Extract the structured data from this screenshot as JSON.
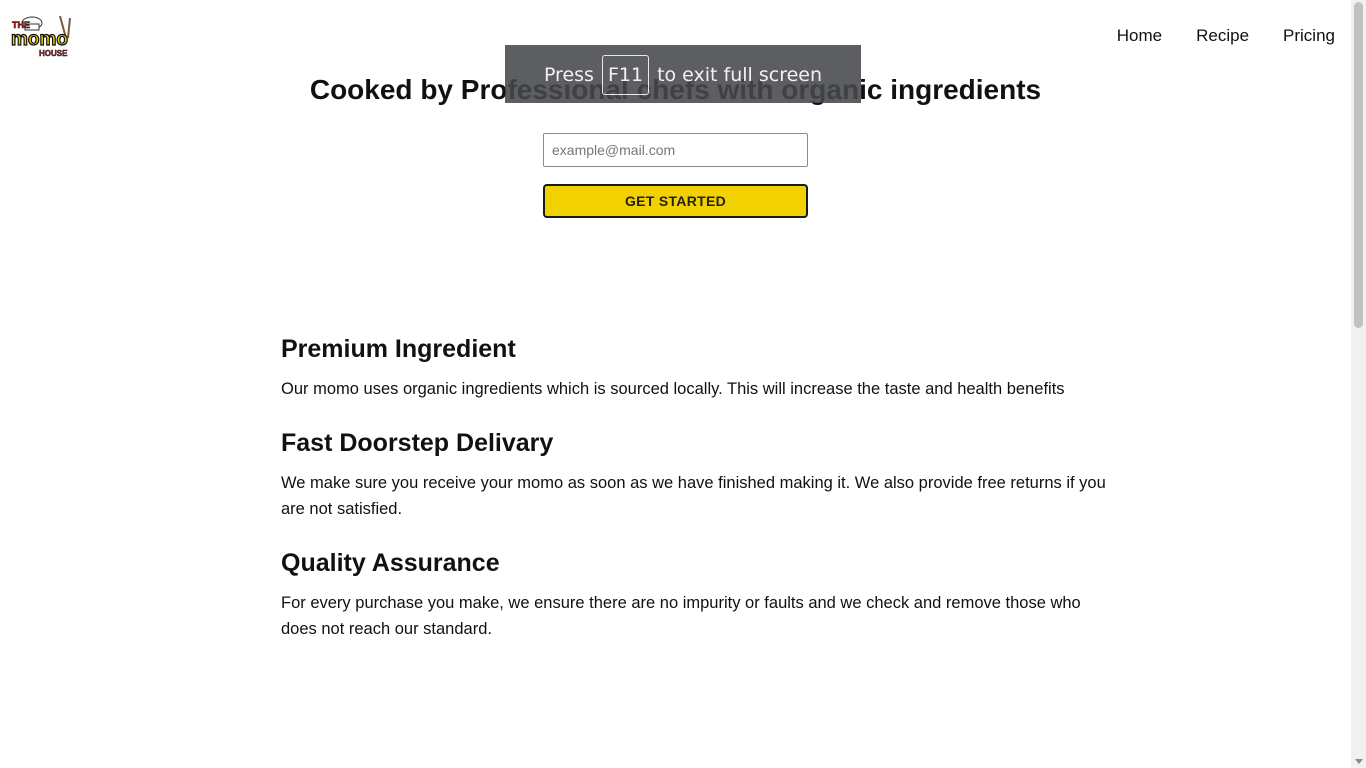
{
  "logo": {
    "alt": "THE momo HOUSE",
    "text_top": "THE",
    "text_main": "momo",
    "text_bottom": "HOUSE"
  },
  "nav": {
    "items": [
      "Home",
      "Recipe",
      "Pricing"
    ]
  },
  "hero": {
    "title": "Cooked by Professional chefs with organic ingredients",
    "email_placeholder": "example@mail.com",
    "cta_label": "GET STARTED"
  },
  "fullscreen_notice": {
    "before": "Press",
    "key": "F11",
    "after": "to exit full screen"
  },
  "features": [
    {
      "title": "Premium Ingredient",
      "text": "Our momo uses organic ingredients which is sourced locally. This will increase the taste and health benefits"
    },
    {
      "title": "Fast Doorstep Delivary",
      "text": "We make sure you receive your momo as soon as we have finished making it. We also provide free returns if you are not satisfied."
    },
    {
      "title": "Quality Assurance",
      "text": "For every purchase you make, we ensure there are no impurity or faults and we check and remove those who does not reach our standard."
    }
  ],
  "colors": {
    "accent": "#f2d100",
    "text": "#111111",
    "overlay": "#46484c"
  }
}
